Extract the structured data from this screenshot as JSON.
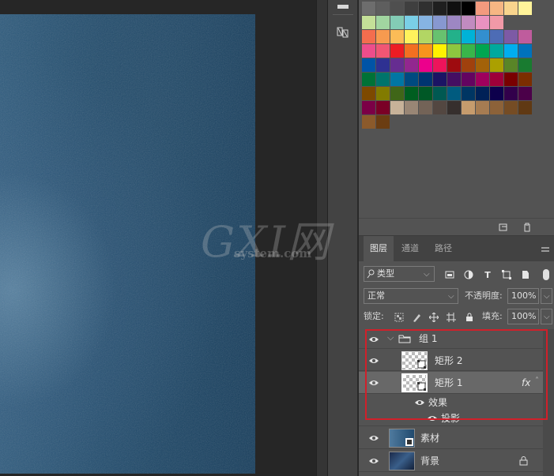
{
  "watermark": {
    "logo_text": "GXI网",
    "sub_text": "system.com"
  },
  "swatches": {
    "rows": [
      [
        "#6d6d6d",
        "#5e5e5e",
        "#4f4f4f",
        "#3f3f3f",
        "#303030",
        "#1f1f1f",
        "#101010",
        "#000000",
        "#f29a7e",
        "#f6b683",
        "#f8d48d",
        "#fff39a"
      ],
      [
        "#c4e098",
        "#a1d5a0",
        "#83ccb5",
        "#7acfe7",
        "#86b4e2",
        "#8798d0",
        "#9d87c3",
        "#c18bc0",
        "#e992c0",
        "#f199a7"
      ],
      [
        "#f36d4e",
        "#f79a4f",
        "#fbbc57",
        "#fff25c",
        "#b2d664",
        "#68c16f",
        "#23b18a",
        "#00b2d7",
        "#338fcf",
        "#4d6cb5",
        "#7d5aa5",
        "#bf5c9d"
      ],
      [
        "#ed4d8b",
        "#f05674",
        "#ed1c24",
        "#f36f21",
        "#f7941d",
        "#fff200",
        "#8dc63f",
        "#39b54a",
        "#00a651",
        "#00a99d",
        "#00aeef",
        "#0072bc"
      ],
      [
        "#0054a6",
        "#2e3192",
        "#662d91",
        "#92278f",
        "#ec008c",
        "#ed145b",
        "#9e0b0f",
        "#a0410d",
        "#a36209",
        "#aba000",
        "#598527",
        "#197b30"
      ],
      [
        "#007236",
        "#00746b",
        "#0076a3",
        "#004a80",
        "#003471",
        "#1b1464",
        "#440e62",
        "#630460",
        "#9e005d",
        "#9e0039",
        "#790000",
        "#7b2e00"
      ],
      [
        "#7d4900",
        "#827b00",
        "#406618",
        "#005e20",
        "#005826",
        "#005952",
        "#005b7f",
        "#003663",
        "#002157",
        "#0d004c",
        "#32004b",
        "#4b0049"
      ],
      [
        "#7b0046",
        "#7a0026",
        "#c7b299",
        "#998675",
        "#736357",
        "#534741",
        "#362f2d",
        "#c69c6d",
        "#a67c52",
        "#8c6239",
        "#754c24",
        "#603913"
      ],
      [
        "#8b5a2b",
        "#6b3d12"
      ]
    ]
  },
  "layers_panel": {
    "tabs": [
      "图层",
      "通道",
      "路径"
    ],
    "filter_kind": "类型",
    "blend_mode": "正常",
    "opacity_label": "不透明度:",
    "opacity_value": "100%",
    "lock_label": "锁定:",
    "fill_label": "填充:",
    "fill_value": "100%",
    "layers": [
      {
        "name": "组 1",
        "kind": "group"
      },
      {
        "name": "矩形 2",
        "kind": "shape"
      },
      {
        "name": "矩形 1",
        "kind": "shape",
        "fx": "fx"
      },
      {
        "name": "效果",
        "kind": "effects"
      },
      {
        "name": "投影",
        "kind": "effect"
      },
      {
        "name": "素材",
        "kind": "image"
      },
      {
        "name": "背景",
        "kind": "background"
      }
    ]
  },
  "colors": {
    "highlight": "#d0202a",
    "panel_bg": "#535353",
    "selected_row": "#686868"
  }
}
